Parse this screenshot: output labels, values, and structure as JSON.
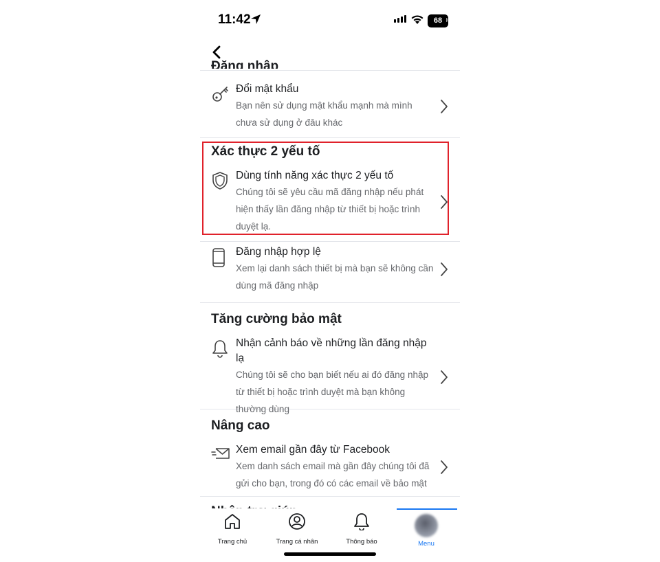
{
  "status": {
    "time": "11:42",
    "battery": "68"
  },
  "truncated_heading": "Đăng nhập",
  "sections": {
    "password": {
      "title": "Đổi mật khẩu",
      "desc": "Bạn nên sử dụng mật khẩu mạnh mà mình chưa sử dụng ở đâu khác",
      "icon": "key-icon"
    },
    "two_factor": {
      "heading": "Xác thực 2 yếu tố",
      "title": "Dùng tính năng xác thực 2 yếu tố",
      "desc": "Chúng tôi sẽ yêu cầu mã đăng nhập nếu phát hiện thấy lần đăng nhập từ thiết bị hoặc trình duyệt lạ.",
      "icon": "shield-icon"
    },
    "authorized_logins": {
      "title": "Đăng nhập hợp lệ",
      "desc": "Xem lại danh sách thiết bị mà bạn sẽ không cần dùng mã đăng nhập",
      "icon": "phone-icon"
    },
    "extra_security": {
      "heading": "Tăng cường bảo mật",
      "title": "Nhận cảnh báo về những lần đăng nhập lạ",
      "desc": "Chúng tôi sẽ cho bạn biết nếu ai đó đăng nhập từ thiết bị hoặc trình duyệt mà bạn không thường dùng",
      "icon": "bell-icon"
    },
    "advanced": {
      "heading": "Nâng cao",
      "title": "Xem email gần đây từ Facebook",
      "desc": "Xem danh sách email mà gần đây chúng tôi đã gửi cho bạn, trong đó có các email về bảo mật",
      "icon": "email-icon"
    },
    "help": {
      "heading": "Nhận trợ giúp"
    }
  },
  "tabs": [
    {
      "label": "Trang chủ",
      "icon": "home-icon"
    },
    {
      "label": "Trang cá nhân",
      "icon": "profile-icon"
    },
    {
      "label": "Thông báo",
      "icon": "bell-icon"
    },
    {
      "label": "Menu",
      "icon": "avatar",
      "active": true
    }
  ],
  "colors": {
    "accent": "#1877f2",
    "highlight_border": "#e0222b",
    "secondary_text": "#65676b"
  }
}
